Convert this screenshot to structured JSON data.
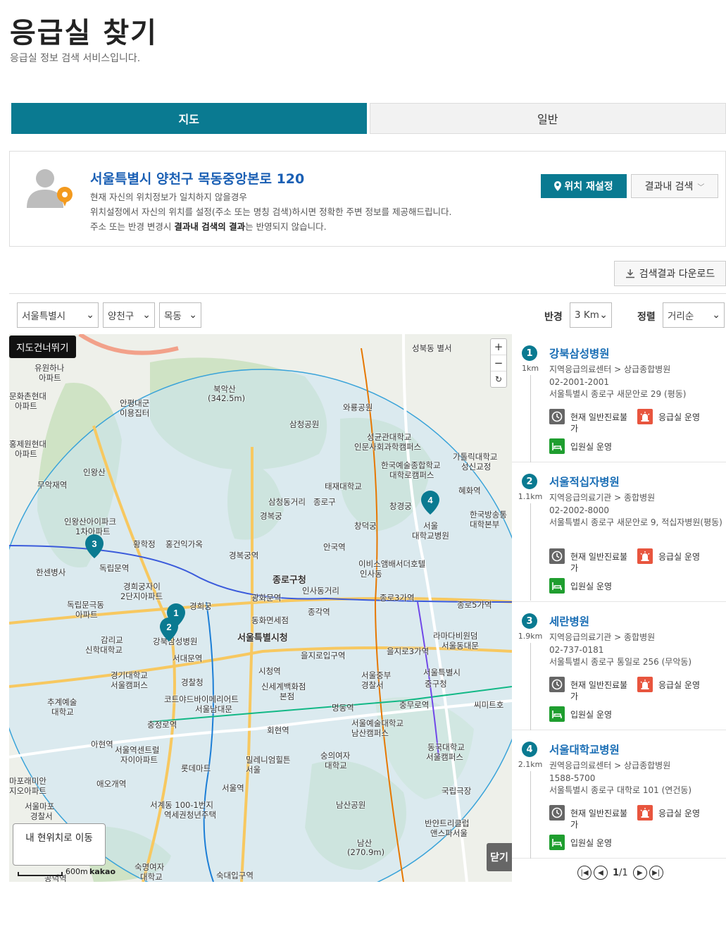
{
  "header": {
    "title": "응급실 찾기",
    "subtitle": "응급실 정보 검색 서비스입니다."
  },
  "tabs": [
    {
      "label": "지도",
      "active": true
    },
    {
      "label": "일반",
      "active": false
    }
  ],
  "location": {
    "address": "서울특별시 양천구 목동중앙본로 120",
    "line1": "현재 자신의 위치정보가 일치하지 않을경우",
    "line2": "위치설정에서 자신의 위치를 설정(주소 또는 명칭 검색)하시면 정확한 주변 정보를 제공해드립니다.",
    "line3_pre": "주소 또는 반경 변경시 ",
    "line3_bold": "결과내 검색의 결과",
    "line3_post": "는 반영되지 않습니다.",
    "reset_label": "위치 재설정",
    "search_in_label": "결과내 검색"
  },
  "download_label": "검색결과 다운로드",
  "filters": {
    "city": "서울특별시",
    "district": "양천구",
    "dong": "목동",
    "radius_label": "반경",
    "radius_value": "3 Km",
    "sort_label": "정렬",
    "sort_value": "거리순"
  },
  "map": {
    "skip_label": "지도건너뛰기",
    "zoom_in": "+",
    "zoom_out": "−",
    "reset": "↻",
    "my_location_label": "내 현위치로 이동",
    "close_label": "닫기",
    "scale_label": "600m",
    "provider": "kakao",
    "labels": [
      "성북동 별서",
      "유원하나",
      "아파트",
      "문화촌현대",
      "아파트",
      "안평대군",
      "이용집터",
      "북악산",
      "(342.5m)",
      "와룡공원",
      "삼청공원",
      "성균관대학교",
      "인문사회과학캠퍼스",
      "한국예술종합학교",
      "대학로캠퍼스",
      "가톨릭대학교",
      "성신교정",
      "홍제원현대",
      "아파트",
      "인왕산",
      "무악재역",
      "태재대학교",
      "혜화역",
      "삼청동거리",
      "종로구",
      "창경궁",
      "한국방송통",
      "대학본부",
      "인왕산아이파크",
      "1차아파트",
      "창덕궁",
      "서울",
      "대학교병원",
      "황학정",
      "홍건익가옥",
      "경복궁",
      "안국역",
      "한센병사",
      "독립문역",
      "경복궁역",
      "이비스앰배서더호텔",
      "인사동",
      "종로구청",
      "경희궁자이",
      "2단지아파트",
      "인사동거리",
      "독립문극동",
      "아파트",
      "경희궁",
      "광화문역",
      "종로3가역",
      "종로5가역",
      "동화면세점",
      "종각역",
      "강북삼성병원",
      "서울특별시청",
      "라마다비원덤",
      "서울동대문",
      "감리교",
      "신학대학교",
      "서대문역",
      "을지로입구역",
      "을지로3가역",
      "경기대학교",
      "서울캠퍼스",
      "시청역",
      "서울중부",
      "경찰서",
      "서울특별시",
      "중구청",
      "경찰청",
      "신세계백화점",
      "본점",
      "추계예술",
      "대학교",
      "코트야드바이메리어트",
      "서울남대문",
      "명동역",
      "충무로역",
      "씨미트호",
      "충정로역",
      "회현역",
      "서울예술대학교",
      "남산캠퍼스",
      "아현역",
      "서울역센트럴",
      "자이아파트",
      "밀레니엄힐튼",
      "서울",
      "숭의여자",
      "대학교",
      "동국대학교",
      "서울캠퍼스",
      "롯데마트",
      "애오개역",
      "서울역",
      "국립극장",
      "마포래미안",
      "지오아파트",
      "서계동 100-1번지",
      "역세권청년주택",
      "남산공원",
      "서울마포",
      "경찰서",
      "반얀트리클럽",
      "앤스파서울",
      "남산",
      "(270.9m)",
      "숙명여자",
      "대학교",
      "숙대입구역",
      "공덕역"
    ]
  },
  "results": [
    {
      "num": "1",
      "dist": "1km",
      "name": "강북삼성병원",
      "type": "지역응급의료센터 > 상급종합병원",
      "phone": "02-2001-2001",
      "address": "서울특별시 종로구 새문안로 29 (평동)",
      "badge1": "현재 일반진료불가",
      "badge2": "응급실 운영",
      "badge3": "입원실 운영"
    },
    {
      "num": "2",
      "dist": "1.1km",
      "name": "서울적십자병원",
      "type": "지역응급의료기관 > 종합병원",
      "phone": "02-2002-8000",
      "address": "서울특별시 종로구 새문안로 9, 적십자병원(평동)",
      "badge1": "현재 일반진료불가",
      "badge2": "응급실 운영",
      "badge3": "입원실 운영"
    },
    {
      "num": "3",
      "dist": "1.9km",
      "name": "세란병원",
      "type": "지역응급의료기관 > 종합병원",
      "phone": "02-737-0181",
      "address": "서울특별시 종로구 통일로 256 (무악동)",
      "badge1": "현재 일반진료불가",
      "badge2": "응급실 운영",
      "badge3": "입원실 운영"
    },
    {
      "num": "4",
      "dist": "2.1km",
      "name": "서울대학교병원",
      "type": "권역응급의료센터 > 상급종합병원",
      "phone": "1588-5700",
      "address": "서울특별시 종로구 대학로 101 (연건동)",
      "badge1": "현재 일반진료불가",
      "badge2": "응급실 운영",
      "badge3": "입원실 운영"
    }
  ],
  "pager": {
    "current": "1",
    "total": "/1"
  },
  "colors": {
    "accent": "#0a7a91",
    "link": "#1a6eb5",
    "badge_red": "#e8553e",
    "badge_green": "#1f9e2f",
    "badge_gray": "#666666"
  }
}
